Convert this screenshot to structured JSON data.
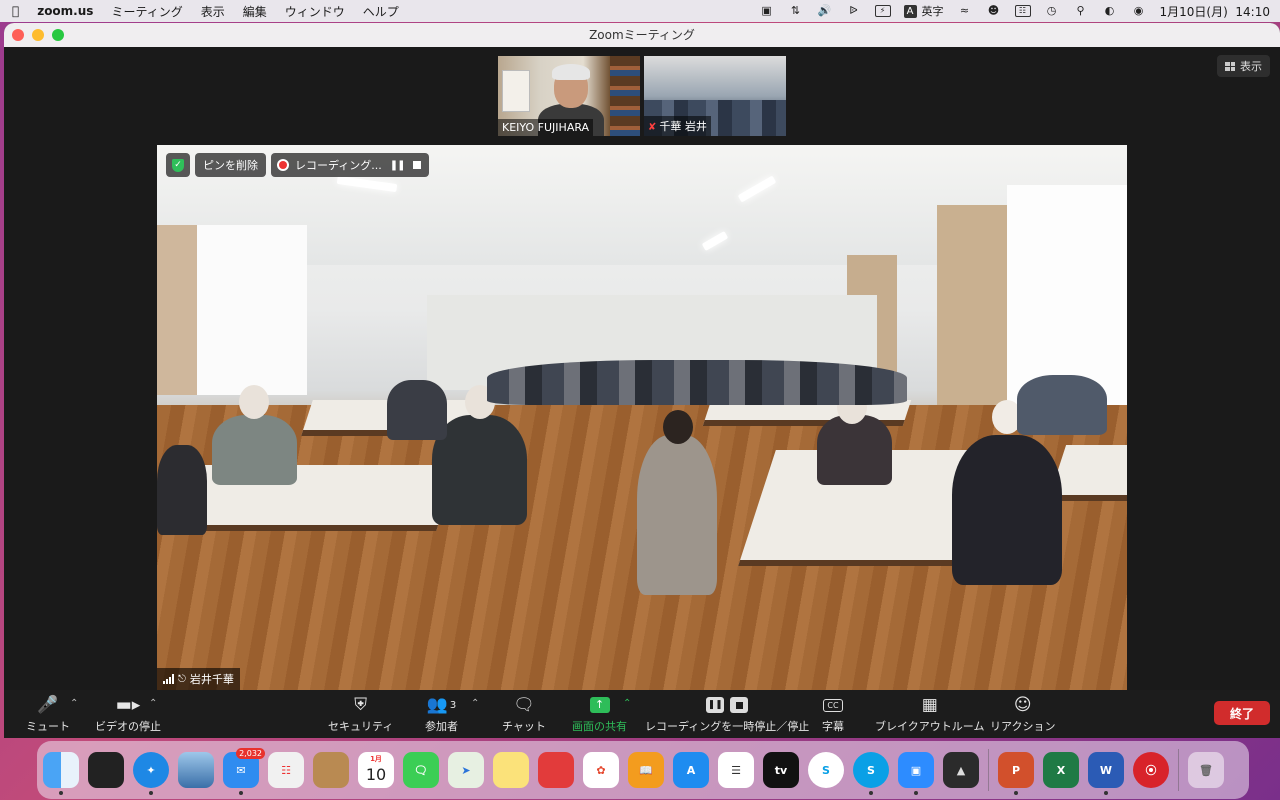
{
  "menubar": {
    "app": "zoom.us",
    "menus": [
      "ミーティング",
      "表示",
      "編集",
      "ウィンドウ",
      "ヘルプ"
    ],
    "ime_mode": "英字",
    "ime_letter": "A",
    "clock": "1月10日(月)  14:10"
  },
  "window": {
    "title": "Zoomミーティング",
    "view_button": "表示"
  },
  "thumbnails": [
    {
      "name": "KEIYO FUJIHARA",
      "muted": false
    },
    {
      "name": "千華 岩井",
      "muted": true
    }
  ],
  "main_video": {
    "unpin_label": "ピンを削除",
    "recording_label": "レコーディング...",
    "speaker_name": "岩井千華"
  },
  "toolbar": {
    "mute": "ミュート",
    "video": "ビデオの停止",
    "security": "セキュリティ",
    "participants": "参加者",
    "participants_count": "3",
    "chat": "チャット",
    "share": "画面の共有",
    "recording": "レコーディングを一時停止／停止",
    "captions": "字幕",
    "cc": "CC",
    "breakout": "ブレイクアウトルーム",
    "reactions": "リアクション",
    "end": "終了"
  },
  "dock": {
    "mail_badge": "2,032",
    "calendar_month": "1月",
    "calendar_day": "10",
    "tv_label": "tv"
  },
  "colors": {
    "share_green": "#2ebd59",
    "end_red": "#d12c2c",
    "shield_green": "#2fbf5a"
  }
}
